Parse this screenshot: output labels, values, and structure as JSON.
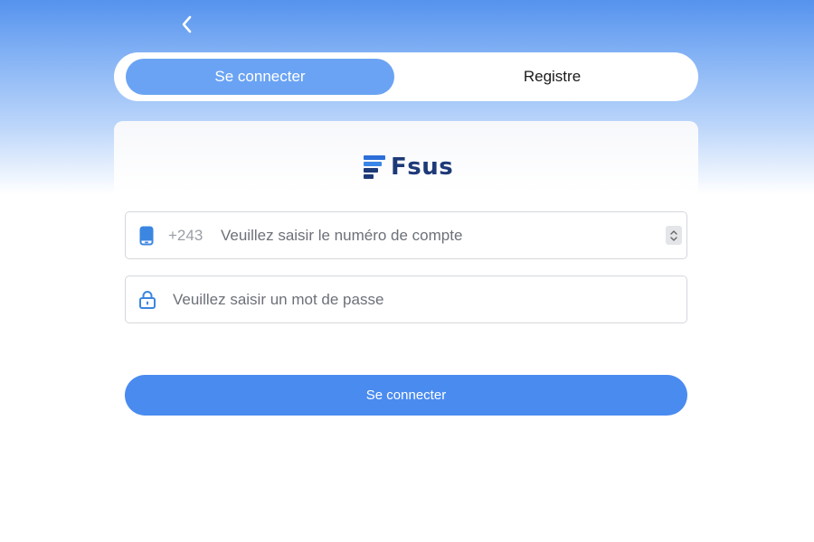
{
  "nav": {
    "back_icon": "chevron-left-icon"
  },
  "tabs": {
    "login_label": "Se connecter",
    "register_label": "Registre"
  },
  "brand": {
    "logo_text": "Fsus",
    "logo_color": "#1d3a78",
    "mark_color": "#2d6fd8"
  },
  "form": {
    "phone": {
      "icon": "phone-icon",
      "country_code": "+243",
      "placeholder": "Veuillez saisir le numéro de compte",
      "value": ""
    },
    "password": {
      "icon": "lock-icon",
      "placeholder": "Veuillez saisir un mot de passe",
      "value": ""
    },
    "submit_label": "Se connecter"
  },
  "colors": {
    "accent": "#4a8bf0",
    "active_tab": "#6aa3f3",
    "header_gradient_top": "#5593ee"
  }
}
